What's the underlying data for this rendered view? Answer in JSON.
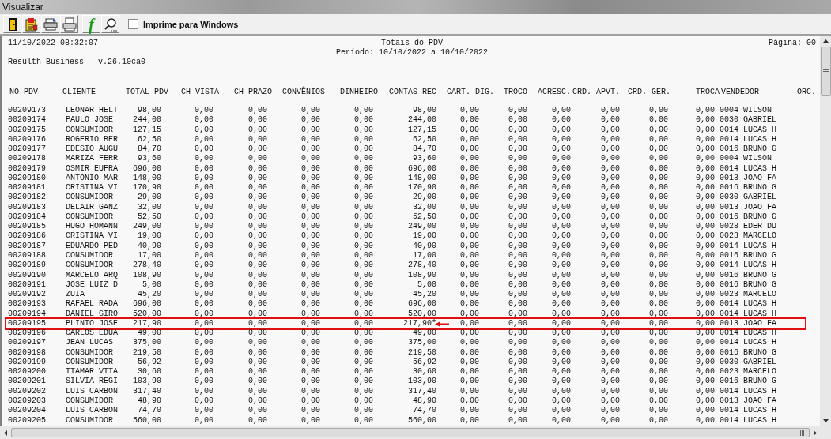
{
  "window": {
    "title": "Visualizar"
  },
  "toolbar": {
    "buttons": [
      {
        "kind": "exit"
      },
      {
        "kind": "report"
      },
      {
        "kind": "print-setup"
      },
      {
        "kind": "print"
      },
      {
        "kind": "text",
        "label": "f"
      },
      {
        "kind": "zoom"
      }
    ],
    "checkbox": {
      "label": "Imprime para Windows",
      "checked": false
    }
  },
  "report": {
    "timestamp": "11/10/2022 08:32:07",
    "title": "Totais do PDV",
    "page": "Página: 00",
    "period": "Período: 10/10/2022 a 10/10/2022",
    "system": "Resulth Business - v.26.10ca0",
    "columns": [
      "NO PDV",
      "CLIENTE",
      "TOTAL PDV",
      "CH VISTA",
      "CH PRAZO",
      "CONVÊNIOS",
      "DINHEIRO",
      "CONTAS REC",
      "CART. DIG.",
      "TROCO",
      "ACRESC.",
      "CRD. APVT.",
      "CRD. GER.",
      "TROCA",
      "VENDEDOR",
      "ORC."
    ],
    "rows": [
      {
        "cells": [
          "00209173",
          "LEONAR HELT",
          "98,00",
          "0,00",
          "0,00",
          "0,00",
          "0,00",
          "98,00",
          "0,00",
          "0,00",
          "0,00",
          "0,00",
          "0,00",
          "0,00",
          "0004 WILSON"
        ],
        "marked": false
      },
      {
        "cells": [
          "00209174",
          "PAULO JOSE",
          "244,00",
          "0,00",
          "0,00",
          "0,00",
          "0,00",
          "244,00",
          "0,00",
          "0,00",
          "0,00",
          "0,00",
          "0,00",
          "0,00",
          "0030 GABRIEL"
        ],
        "marked": false
      },
      {
        "cells": [
          "00209175",
          "CONSUMIDOR",
          "127,15",
          "0,00",
          "0,00",
          "0,00",
          "0,00",
          "127,15",
          "0,00",
          "0,00",
          "0,00",
          "0,00",
          "0,00",
          "0,00",
          "0014 LUCAS H"
        ],
        "marked": false
      },
      {
        "cells": [
          "00209176",
          "ROGERIO BER",
          "62,50",
          "0,00",
          "0,00",
          "0,00",
          "0,00",
          "62,50",
          "0,00",
          "0,00",
          "0,00",
          "0,00",
          "0,00",
          "0,00",
          "0014 LUCAS H"
        ],
        "marked": false
      },
      {
        "cells": [
          "00209177",
          "EDESIO AUGU",
          "84,70",
          "0,00",
          "0,00",
          "0,00",
          "0,00",
          "84,70",
          "0,00",
          "0,00",
          "0,00",
          "0,00",
          "0,00",
          "0,00",
          "0016 BRUNO G"
        ],
        "marked": false
      },
      {
        "cells": [
          "00209178",
          "MARIZA FERR",
          "93,60",
          "0,00",
          "0,00",
          "0,00",
          "0,00",
          "93,60",
          "0,00",
          "0,00",
          "0,00",
          "0,00",
          "0,00",
          "0,00",
          "0004 WILSON"
        ],
        "marked": false
      },
      {
        "cells": [
          "00209179",
          "OSMIR EUFRA",
          "696,00",
          "0,00",
          "0,00",
          "0,00",
          "0,00",
          "696,00",
          "0,00",
          "0,00",
          "0,00",
          "0,00",
          "0,00",
          "0,00",
          "0014 LUCAS H"
        ],
        "marked": false
      },
      {
        "cells": [
          "00209180",
          "ANTONIO MAR",
          "148,00",
          "0,00",
          "0,00",
          "0,00",
          "0,00",
          "148,00",
          "0,00",
          "0,00",
          "0,00",
          "0,00",
          "0,00",
          "0,00",
          "0013 JOAO FA"
        ],
        "marked": false
      },
      {
        "cells": [
          "00209181",
          "CRISTINA VI",
          "170,90",
          "0,00",
          "0,00",
          "0,00",
          "0,00",
          "170,90",
          "0,00",
          "0,00",
          "0,00",
          "0,00",
          "0,00",
          "0,00",
          "0016 BRUNO G"
        ],
        "marked": false
      },
      {
        "cells": [
          "00209182",
          "CONSUMIDOR",
          "29,00",
          "0,00",
          "0,00",
          "0,00",
          "0,00",
          "29,00",
          "0,00",
          "0,00",
          "0,00",
          "0,00",
          "0,00",
          "0,00",
          "0030 GABRIEL"
        ],
        "marked": false
      },
      {
        "cells": [
          "00209183",
          "DELAIR GANZ",
          "32,00",
          "0,00",
          "0,00",
          "0,00",
          "0,00",
          "32,00",
          "0,00",
          "0,00",
          "0,00",
          "0,00",
          "0,00",
          "0,00",
          "0013 JOAO FA"
        ],
        "marked": false
      },
      {
        "cells": [
          "00209184",
          "CONSUMIDOR",
          "52,50",
          "0,00",
          "0,00",
          "0,00",
          "0,00",
          "52,50",
          "0,00",
          "0,00",
          "0,00",
          "0,00",
          "0,00",
          "0,00",
          "0016 BRUNO G"
        ],
        "marked": false
      },
      {
        "cells": [
          "00209185",
          "HUGO HOMANN",
          "249,00",
          "0,00",
          "0,00",
          "0,00",
          "0,00",
          "249,00",
          "0,00",
          "0,00",
          "0,00",
          "0,00",
          "0,00",
          "0,00",
          "0028 EDER DU"
        ],
        "marked": false
      },
      {
        "cells": [
          "00209186",
          "CRISTINA VI",
          "19,00",
          "0,00",
          "0,00",
          "0,00",
          "0,00",
          "19,00",
          "0,00",
          "0,00",
          "0,00",
          "0,00",
          "0,00",
          "0,00",
          "0023 MARCELO"
        ],
        "marked": false
      },
      {
        "cells": [
          "00209187",
          "EDUARDO PED",
          "40,90",
          "0,00",
          "0,00",
          "0,00",
          "0,00",
          "40,90",
          "0,00",
          "0,00",
          "0,00",
          "0,00",
          "0,00",
          "0,00",
          "0014 LUCAS H"
        ],
        "marked": false
      },
      {
        "cells": [
          "00209188",
          "CONSUMIDOR",
          "17,00",
          "0,00",
          "0,00",
          "0,00",
          "0,00",
          "17,00",
          "0,00",
          "0,00",
          "0,00",
          "0,00",
          "0,00",
          "0,00",
          "0016 BRUNO G"
        ],
        "marked": false
      },
      {
        "cells": [
          "00209189",
          "CONSUMIDOR",
          "278,40",
          "0,00",
          "0,00",
          "0,00",
          "0,00",
          "278,40",
          "0,00",
          "0,00",
          "0,00",
          "0,00",
          "0,00",
          "0,00",
          "0014 LUCAS H"
        ],
        "marked": false
      },
      {
        "cells": [
          "00209190",
          "MARCELO ARQ",
          "108,90",
          "0,00",
          "0,00",
          "0,00",
          "0,00",
          "108,90",
          "0,00",
          "0,00",
          "0,00",
          "0,00",
          "0,00",
          "0,00",
          "0016 BRUNO G"
        ],
        "marked": false
      },
      {
        "cells": [
          "00209191",
          "JOSE LUIZ D",
          "5,00",
          "0,00",
          "0,00",
          "0,00",
          "0,00",
          "5,00",
          "0,00",
          "0,00",
          "0,00",
          "0,00",
          "0,00",
          "0,00",
          "0016 BRUNO G"
        ],
        "marked": false
      },
      {
        "cells": [
          "00209192",
          "ZUIA",
          "45,20",
          "0,00",
          "0,00",
          "0,00",
          "0,00",
          "45,20",
          "0,00",
          "0,00",
          "0,00",
          "0,00",
          "0,00",
          "0,00",
          "0023 MARCELO"
        ],
        "marked": false
      },
      {
        "cells": [
          "00209193",
          "RAFAEL RADA",
          "696,00",
          "0,00",
          "0,00",
          "0,00",
          "0,00",
          "696,00",
          "0,00",
          "0,00",
          "0,00",
          "0,00",
          "0,00",
          "0,00",
          "0014 LUCAS H"
        ],
        "marked": false
      },
      {
        "cells": [
          "00209194",
          "DANIEL GIRO",
          "520,00",
          "0,00",
          "0,00",
          "0,00",
          "0,00",
          "520,00",
          "0,00",
          "0,00",
          "0,00",
          "0,00",
          "0,00",
          "0,00",
          "0014 LUCAS H"
        ],
        "marked": false
      },
      {
        "cells": [
          "00209195",
          "PLINIO JOSE",
          "217,90",
          "0,00",
          "0,00",
          "0,00",
          "0,00",
          "217,90*",
          "0,00",
          "0,00",
          "0,00",
          "0,00",
          "0,00",
          "0,00",
          "0013 JOAO FA"
        ],
        "marked": true
      },
      {
        "cells": [
          "00209196",
          "CARLOS EDUA",
          "49,00",
          "0,00",
          "0,00",
          "0,00",
          "0,00",
          "49,00",
          "0,00",
          "0,00",
          "0,00",
          "0,00",
          "0,00",
          "0,00",
          "0014 LUCAS H"
        ],
        "marked": false
      },
      {
        "cells": [
          "00209197",
          "JEAN LUCAS",
          "375,00",
          "0,00",
          "0,00",
          "0,00",
          "0,00",
          "375,00",
          "0,00",
          "0,00",
          "0,00",
          "0,00",
          "0,00",
          "0,00",
          "0014 LUCAS H"
        ],
        "marked": false
      },
      {
        "cells": [
          "00209198",
          "CONSUMIDOR",
          "219,50",
          "0,00",
          "0,00",
          "0,00",
          "0,00",
          "219,50",
          "0,00",
          "0,00",
          "0,00",
          "0,00",
          "0,00",
          "0,00",
          "0016 BRUNO G"
        ],
        "marked": false
      },
      {
        "cells": [
          "00209199",
          "CONSUMIDOR",
          "56,92",
          "0,00",
          "0,00",
          "0,00",
          "0,00",
          "56,92",
          "0,00",
          "0,00",
          "0,00",
          "0,00",
          "0,00",
          "0,00",
          "0030 GABRIEL"
        ],
        "marked": false
      },
      {
        "cells": [
          "00209200",
          "ITAMAR VITA",
          "30,60",
          "0,00",
          "0,00",
          "0,00",
          "0,00",
          "30,60",
          "0,00",
          "0,00",
          "0,00",
          "0,00",
          "0,00",
          "0,00",
          "0023 MARCELO"
        ],
        "marked": false
      },
      {
        "cells": [
          "00209201",
          "SILVIA REGI",
          "103,90",
          "0,00",
          "0,00",
          "0,00",
          "0,00",
          "103,90",
          "0,00",
          "0,00",
          "0,00",
          "0,00",
          "0,00",
          "0,00",
          "0016 BRUNO G"
        ],
        "marked": false
      },
      {
        "cells": [
          "00209202",
          "LUIS CARBON",
          "317,40",
          "0,00",
          "0,00",
          "0,00",
          "0,00",
          "317,40",
          "0,00",
          "0,00",
          "0,00",
          "0,00",
          "0,00",
          "0,00",
          "0014 LUCAS H"
        ],
        "marked": false
      },
      {
        "cells": [
          "00209203",
          "CONSUMIDOR",
          "48,90",
          "0,00",
          "0,00",
          "0,00",
          "0,00",
          "48,90",
          "0,00",
          "0,00",
          "0,00",
          "0,00",
          "0,00",
          "0,00",
          "0013 JOAO FA"
        ],
        "marked": false
      },
      {
        "cells": [
          "00209204",
          "LUIS CARBON",
          "74,70",
          "0,00",
          "0,00",
          "0,00",
          "0,00",
          "74,70",
          "0,00",
          "0,00",
          "0,00",
          "0,00",
          "0,00",
          "0,00",
          "0014 LUCAS H"
        ],
        "marked": false
      },
      {
        "cells": [
          "00209205",
          "CONSUMIDOR",
          "560,00",
          "0,00",
          "0,00",
          "0,00",
          "0,00",
          "560,00",
          "0,00",
          "0,00",
          "0,00",
          "0,00",
          "0,00",
          "0,00",
          "0014 LUCAS H"
        ],
        "marked": false
      }
    ]
  }
}
